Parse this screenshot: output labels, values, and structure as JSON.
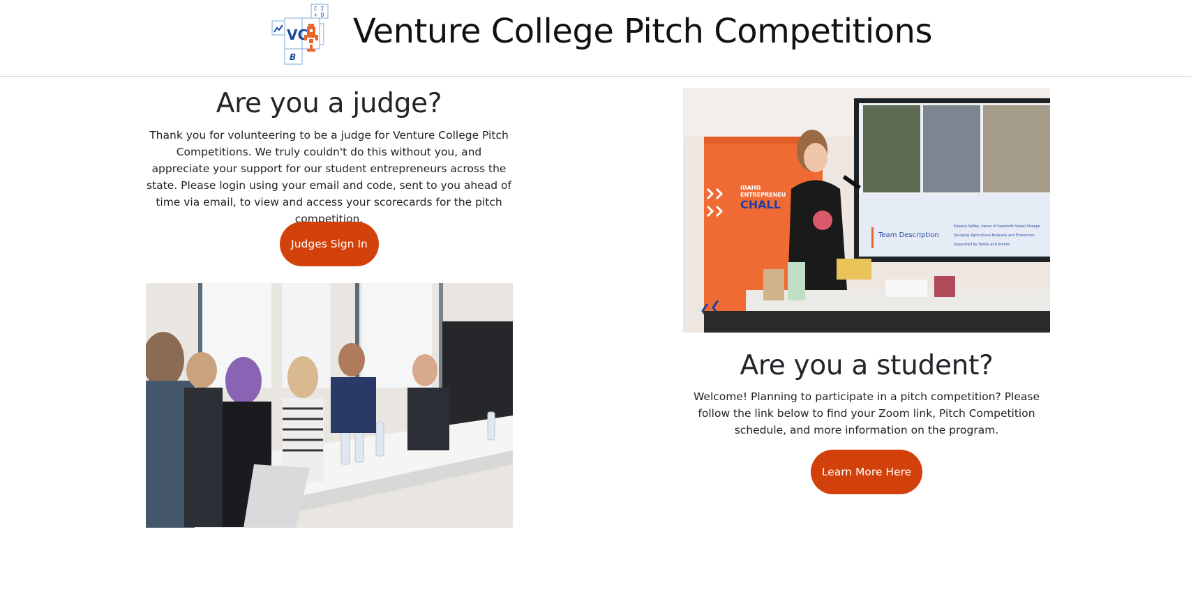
{
  "header": {
    "title": "Venture College Pitch Competitions",
    "logo": {
      "main_letters": "VC",
      "top_letters": "C I",
      "top_letters_2": "+ D",
      "badge_letter": "B"
    }
  },
  "judge": {
    "heading": "Are you a judge?",
    "body": "Thank you for volunteering to be a judge for Venture College Pitch Competitions. We truly couldn't do this without you, and appreciate your support for our student entrepreneurs across the state. Please login using your email and code, sent to you ahead of time via email, to view and access your scorecards for the pitch competition.",
    "button_label": "Judges Sign In"
  },
  "student": {
    "heading": "Are you a student?",
    "body": "Welcome! Planning to participate in a pitch competition? Please follow the link below to find your Zoom link, Pitch Competition schedule, and more information on the program.",
    "button_label": "Learn More Here"
  },
  "photo_pitch": {
    "banner_line1": "IDAHO",
    "banner_line2": "ENTREPRENEU",
    "banner_line3": "CHALL",
    "screen_heading": "Team Description",
    "screen_bullets": [
      "Kalyssa Saffey, owner of Sawtooth Sweet Shoppe",
      "Studying Agricultural Business and Economics",
      "Supported by family and friends"
    ]
  },
  "colors": {
    "accent": "#d3410b",
    "logo_blue": "#1a4aa0",
    "logo_orange": "#e8662c"
  }
}
